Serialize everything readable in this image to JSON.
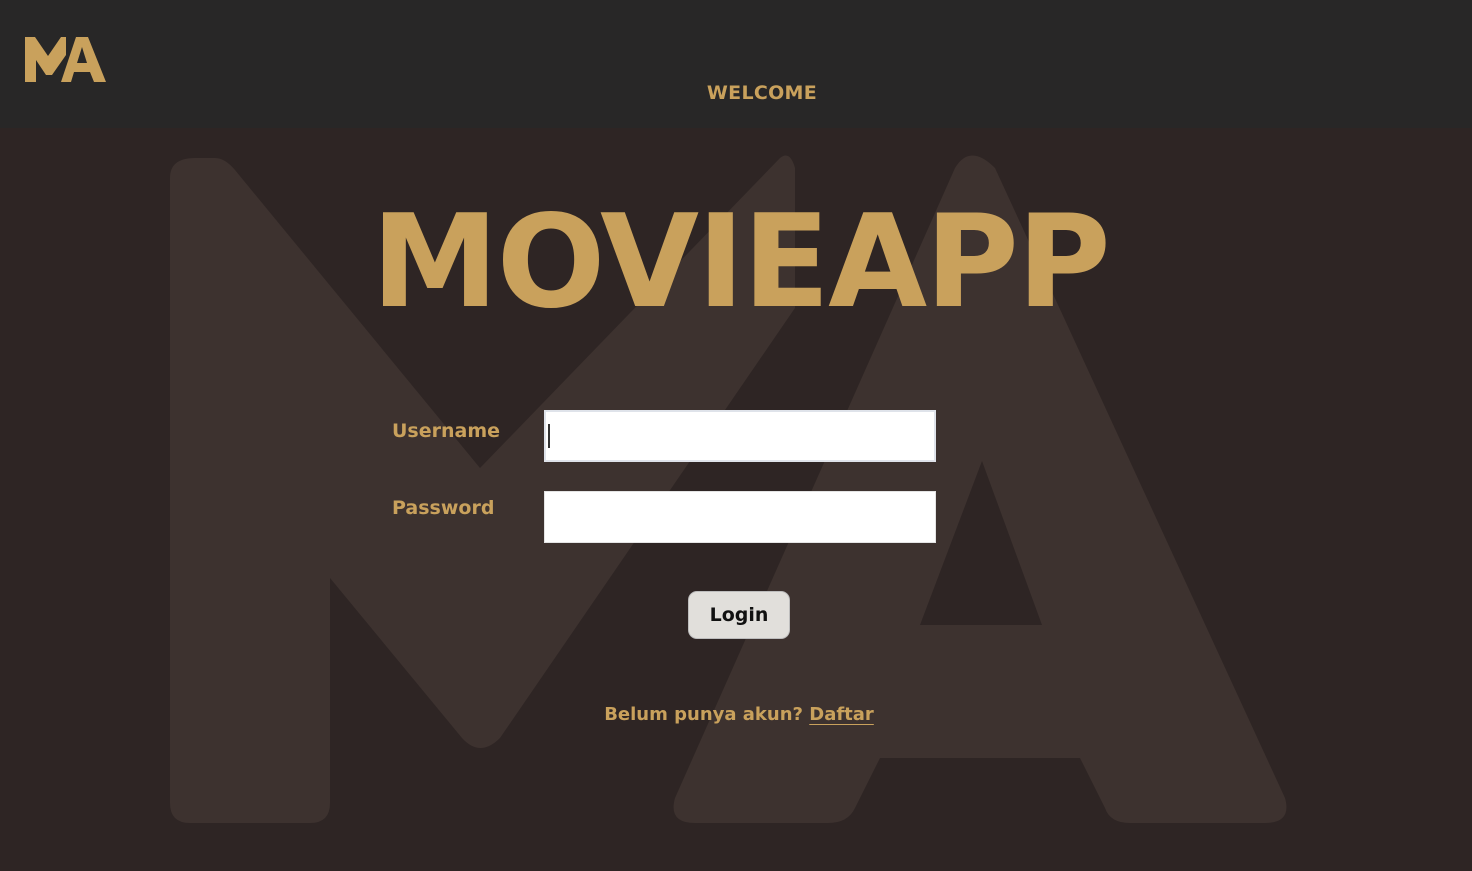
{
  "header": {
    "logo_text": "MA",
    "nav_label": "WELCOME"
  },
  "main": {
    "watermark_text": "MA",
    "title": "MOVIEAPP"
  },
  "login_form": {
    "username_label": "Username",
    "username_value": "",
    "password_label": "Password",
    "password_value": "",
    "login_button_label": "Login"
  },
  "signup": {
    "prompt": "Belum punya akun?",
    "link_label": "Daftar"
  },
  "colors": {
    "header_bg": "#282727",
    "page_bg": "#2e2524",
    "watermark": "#3d322f",
    "accent_gold": "#c9a15c",
    "button_bg": "#e1dfdb"
  }
}
